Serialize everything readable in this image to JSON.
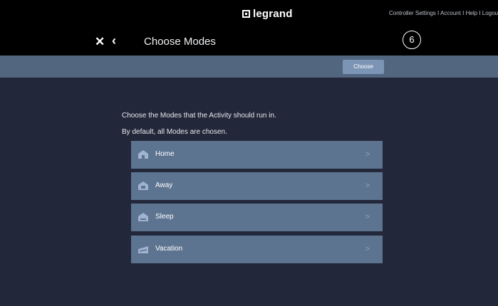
{
  "header": {
    "brand": "legrand",
    "links": [
      "Controller Settings",
      "Account",
      "Help",
      "Logou"
    ],
    "link_separator": " I ",
    "close_glyph": "✕",
    "back_glyph": "‹",
    "title": "Choose Modes",
    "step": "6"
  },
  "toolbar": {
    "choose_label": "Choose"
  },
  "main": {
    "intro_line1": "Choose the Modes that the Activity should run in.",
    "intro_line2": "By default, all Modes are chosen.",
    "modes": [
      {
        "label": "Home",
        "icon": "house-icon"
      },
      {
        "label": "Away",
        "icon": "house-away-icon"
      },
      {
        "label": "Sleep",
        "icon": "house-sleep-icon"
      },
      {
        "label": "Vacation",
        "icon": "vacation-icon"
      }
    ],
    "chevron_glyph": ">"
  },
  "colors": {
    "background": "#23273a",
    "topbar": "#000000",
    "subbar": "#536680",
    "choose_button": "#7d95b5",
    "row": "#5d7491",
    "icon": "#9fb4cf"
  }
}
